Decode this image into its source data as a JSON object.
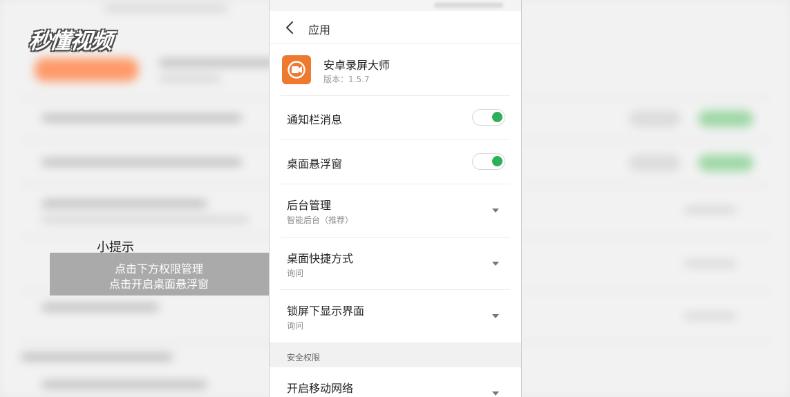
{
  "watermark": {
    "logo_text": "秒懂视频"
  },
  "tip": {
    "title": "小提示",
    "line1": "点击下方权限管理",
    "line2": "点击开启桌面悬浮窗"
  },
  "header": {
    "title": "应用",
    "back_icon": "chevron-left-icon"
  },
  "app": {
    "name": "安卓录屏大师",
    "version": "版本：1.5.7",
    "icon_color": "#ee7a2f"
  },
  "settings": [
    {
      "title": "通知栏消息",
      "control": "toggle",
      "state": "on"
    },
    {
      "title": "桌面悬浮窗",
      "control": "toggle",
      "state": "on"
    },
    {
      "title": "后台管理",
      "subtitle": "智能后台（推荐）",
      "control": "dropdown"
    },
    {
      "title": "桌面快捷方式",
      "subtitle": "询问",
      "control": "dropdown"
    },
    {
      "title": "锁屏下显示界面",
      "subtitle": "询问",
      "control": "dropdown"
    }
  ],
  "section": {
    "label": "安全权限"
  },
  "security_settings": [
    {
      "title": "开启移动网络",
      "control": "dropdown"
    }
  ],
  "colors": {
    "toggle_on": "#2fae5c",
    "tip_accent": "#0f7f6f",
    "app_accent": "#ee7a2f"
  }
}
